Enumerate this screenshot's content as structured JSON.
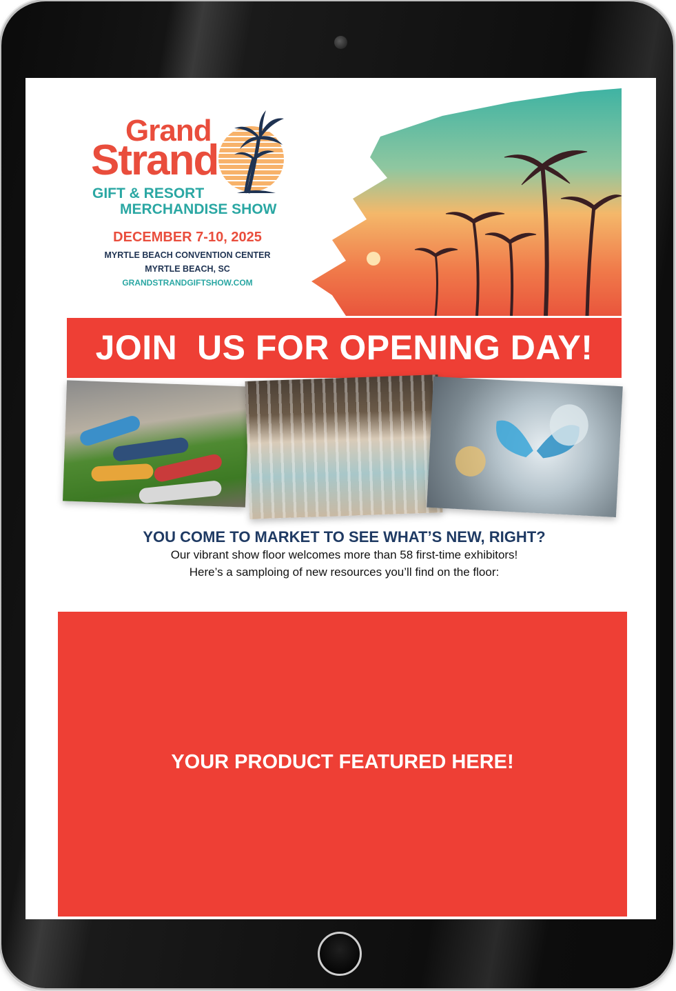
{
  "logo": {
    "line1": "Grand",
    "line2": "Strand",
    "sub1": "GIFT & RESORT",
    "sub2": "MERCHANDISE SHOW"
  },
  "show": {
    "dates": "DECEMBER 7-10, 2025",
    "venue": "MYRTLE BEACH CONVENTION CENTER",
    "city": "MYRTLE BEACH, SC",
    "website": "GRANDSTRANDGIFTSHOW.COM"
  },
  "banner": {
    "headline": "JOIN  US FOR OPENING DAY!"
  },
  "intro": {
    "heading": "YOU COME TO MARKET TO SEE WHAT’S NEW, RIGHT?",
    "line1": "Our vibrant show floor welcomes more than 58 first-time exhibitors!",
    "line2": "Here’s a samploing of new resources you’ll find on the floor:"
  },
  "feature": {
    "label": "YOUR PRODUCT FEATURED HERE!"
  },
  "colors": {
    "brand_red": "#ee3f35",
    "brand_teal": "#2aa7a3",
    "navy": "#1f3a63",
    "device_frame": "#0b0b0b"
  }
}
